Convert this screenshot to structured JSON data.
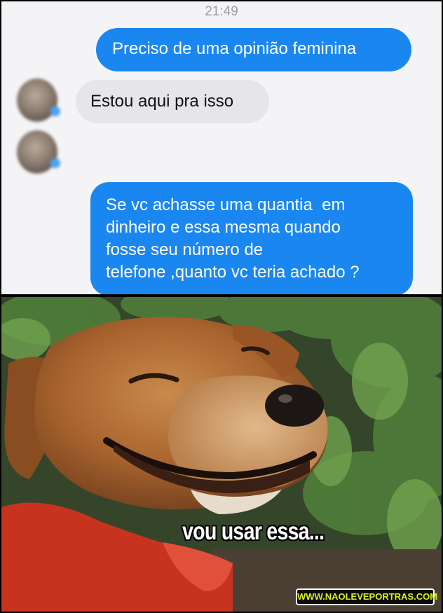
{
  "chat": {
    "timestamp": "21:49",
    "messages": [
      {
        "direction": "outgoing",
        "text": "Preciso de uma opinião feminina"
      },
      {
        "direction": "incoming",
        "text": "Estou aqui pra isso"
      },
      {
        "direction": "outgoing",
        "lines": [
          "Se vc achasse uma quantia  em",
          "dinheiro e essa mesma quando",
          "fosse seu número de",
          "telefone ,quanto vc teria achado ?"
        ]
      }
    ],
    "colors": {
      "outgoing_bubble": "#1a87f0",
      "incoming_bubble": "#e6e6ea",
      "background": "#f4f4f6"
    }
  },
  "meme": {
    "image_subject": "smiling dog with squinting eyes in front of green plants",
    "caption": "vou usar essa...",
    "watermark": "WWW.NAOLEVEPORTRAS.COM",
    "watermark_color": "#d8f21a"
  },
  "icons": {
    "avatar": "blurred-profile-avatar",
    "status": "online-dot-icon"
  }
}
